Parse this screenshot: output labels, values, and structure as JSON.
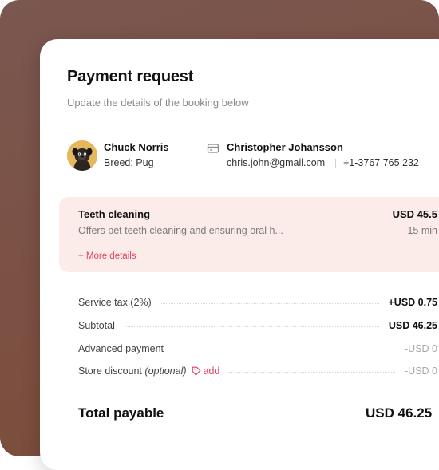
{
  "colors": {
    "accent": "#e2445c",
    "service_bg": "#fbecea",
    "backdrop": "#7c5042"
  },
  "header": {
    "title": "Payment request",
    "subtitle": "Update the details of the booking below"
  },
  "pet": {
    "name": "Chuck Norris",
    "breed": "Breed: Pug",
    "avatar_icon": "pug-avatar"
  },
  "owner": {
    "icon": "id-card-icon",
    "name": "Christopher Johansson",
    "email": "chris.john@gmail.com",
    "phone": "+1-3767 765 232"
  },
  "service": {
    "name": "Teeth cleaning",
    "price": "USD 45.5",
    "description": "Offers pet teeth cleaning and ensuring oral h...",
    "duration": "15 min",
    "more_details": "+ More details"
  },
  "summary": {
    "service_tax": {
      "label": "Service tax (2%)",
      "value": "+USD 0.75"
    },
    "subtotal": {
      "label": "Subtotal",
      "value": "USD 46.25"
    },
    "advanced_payment": {
      "label": "Advanced payment",
      "value": "-USD 0"
    },
    "store_discount": {
      "label": "Store discount",
      "optional": "(optional)",
      "add": "add",
      "value": "-USD 0"
    }
  },
  "total": {
    "label": "Total payable",
    "value": "USD 46.25"
  }
}
